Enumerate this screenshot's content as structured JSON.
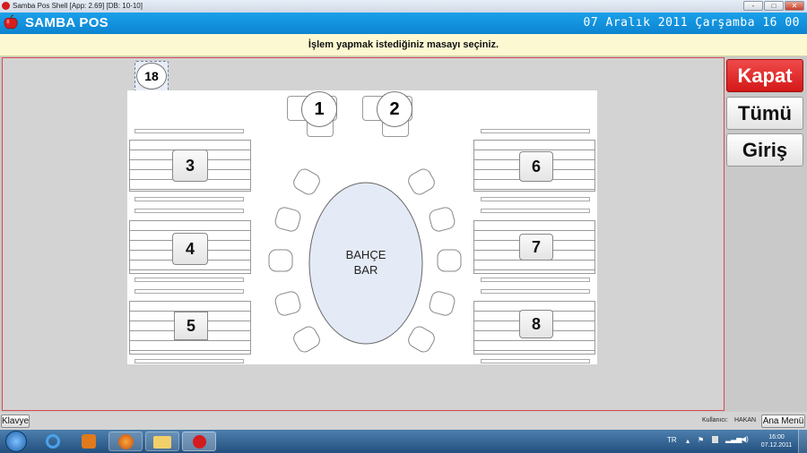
{
  "window": {
    "title": "Samba Pos Shell [App: 2.69] [DB: 10-10]",
    "controls": [
      "-",
      "□",
      "✕"
    ]
  },
  "header": {
    "brand": "SAMBA POS",
    "datetime": "07 Aralık 2011 Çarşamba 16 00"
  },
  "instruction": "İşlem yapmak istediğiniz masayı seçiniz.",
  "floor": {
    "tables": [
      "18",
      "1",
      "2",
      "3",
      "4",
      "5",
      "6",
      "7",
      "8"
    ],
    "bar_label_line1": "BAHÇE",
    "bar_label_line2": "BAR"
  },
  "side_buttons": {
    "close": "Kapat",
    "all": "Tümü",
    "login": "Giriş"
  },
  "colors": {
    "close_button": "#e02020",
    "header": "#1296df",
    "instruction_bg": "#fbf8d2"
  },
  "statusbar": {
    "keyboard": "Klavye",
    "user_label": "Kullanıcı:",
    "user_name": "HAKAN",
    "main_menu": "Ana Menü"
  },
  "taskbar": {
    "language": "TR",
    "time": "16:00",
    "date": "07.12.2011",
    "apps": [
      "windows-start-icon",
      "internet-explorer-icon",
      "media-player-icon",
      "firefox-icon",
      "folder-icon",
      "sambapos-icon"
    ]
  }
}
